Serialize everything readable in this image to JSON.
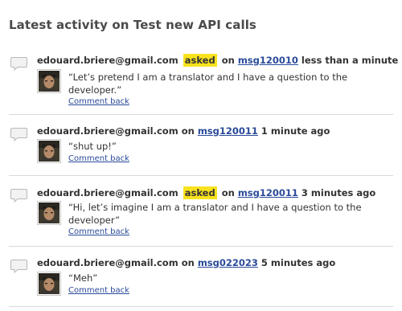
{
  "page": {
    "title": "Latest activity on Test new API calls"
  },
  "colors": {
    "asked_badge": "#f8e21e",
    "link": "#2a4a9a",
    "divider": "#d9d9d9"
  },
  "icons": {
    "comment": "speech-bubble-icon",
    "avatar": "user-avatar-photo"
  },
  "activities": [
    {
      "author": "edouard.briere@gmail.com",
      "action": "asked",
      "on_label": "on",
      "message_id": "msg120010",
      "time": "less than a minute ago",
      "quote": "“Let’s pretend I am a translator and I have a question to the developer.”",
      "comment_back_label": "Comment back"
    },
    {
      "author": "edouard.briere@gmail.com",
      "action": "",
      "on_label": "on",
      "message_id": "msg120011",
      "time": "1 minute ago",
      "quote": "“shut up!”",
      "comment_back_label": "Comment back"
    },
    {
      "author": "edouard.briere@gmail.com",
      "action": "asked",
      "on_label": "on",
      "message_id": "msg120011",
      "time": "3 minutes ago",
      "quote": "“Hi, let’s imagine I am a translator and I have a question to the developer”",
      "comment_back_label": "Comment back"
    },
    {
      "author": "edouard.briere@gmail.com",
      "action": "",
      "on_label": "on",
      "message_id": "msg022023",
      "time": "5 minutes ago",
      "quote": "“Meh”",
      "comment_back_label": "Comment back"
    }
  ]
}
